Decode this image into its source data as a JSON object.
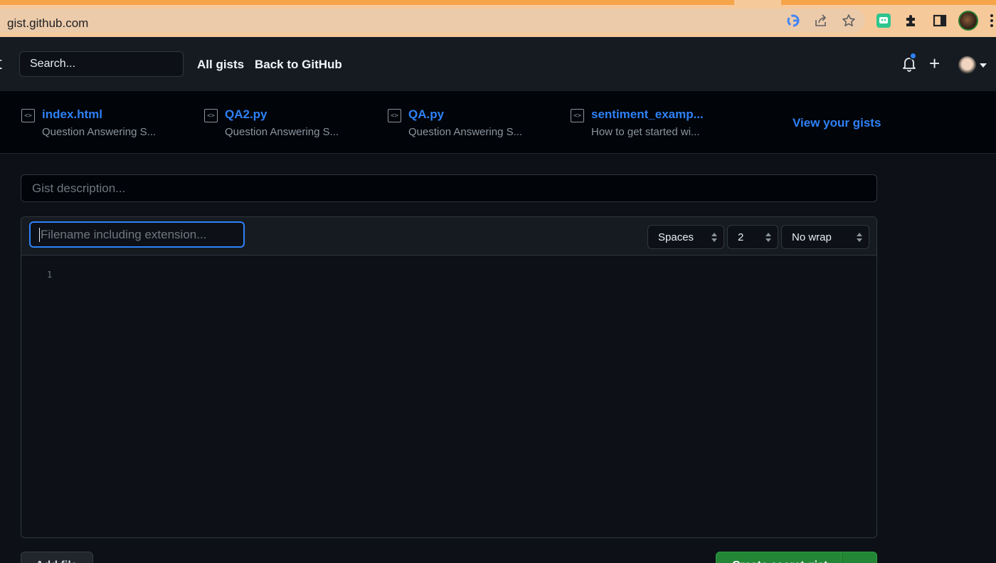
{
  "browser": {
    "url": "gist.github.com",
    "icons": [
      "lock-icon",
      "google-icon",
      "share-icon",
      "star-icon",
      "extension-icon",
      "puzzle-icon",
      "side-panel-icon",
      "profile-avatar",
      "menu-icon"
    ],
    "colors": {
      "tab_strip": "#f5a44a",
      "toolbar": "#f6c99a"
    }
  },
  "header": {
    "logo_fragment": "t",
    "search_placeholder": "Search...",
    "nav": {
      "all_gists": "All gists",
      "back_to_github": "Back to GitHub"
    },
    "icons": [
      "bell-icon",
      "plus-icon",
      "avatar",
      "caret-down-icon"
    ],
    "notification_dot_color": "#2f81f7"
  },
  "recent_gists": {
    "items": [
      {
        "name": "index.html",
        "description": "Question Answering S..."
      },
      {
        "name": "QA2.py",
        "description": "Question Answering S..."
      },
      {
        "name": "QA.py",
        "description": "Question Answering S..."
      },
      {
        "name": "sentiment_examp...",
        "description": "How to get started wi..."
      }
    ],
    "view_all_label": "View your gists"
  },
  "form": {
    "description_placeholder": "Gist description...",
    "filename_placeholder": "Filename including extension...",
    "indent_mode": "Spaces",
    "indent_size": "2",
    "wrap_mode": "No wrap",
    "line_numbers": [
      "1"
    ],
    "add_file_label": "Add file",
    "create_label": "Create secret gist"
  },
  "colors": {
    "accent_blue": "#2f81f7",
    "primary_green": "#238636",
    "background": "#0d1117"
  }
}
